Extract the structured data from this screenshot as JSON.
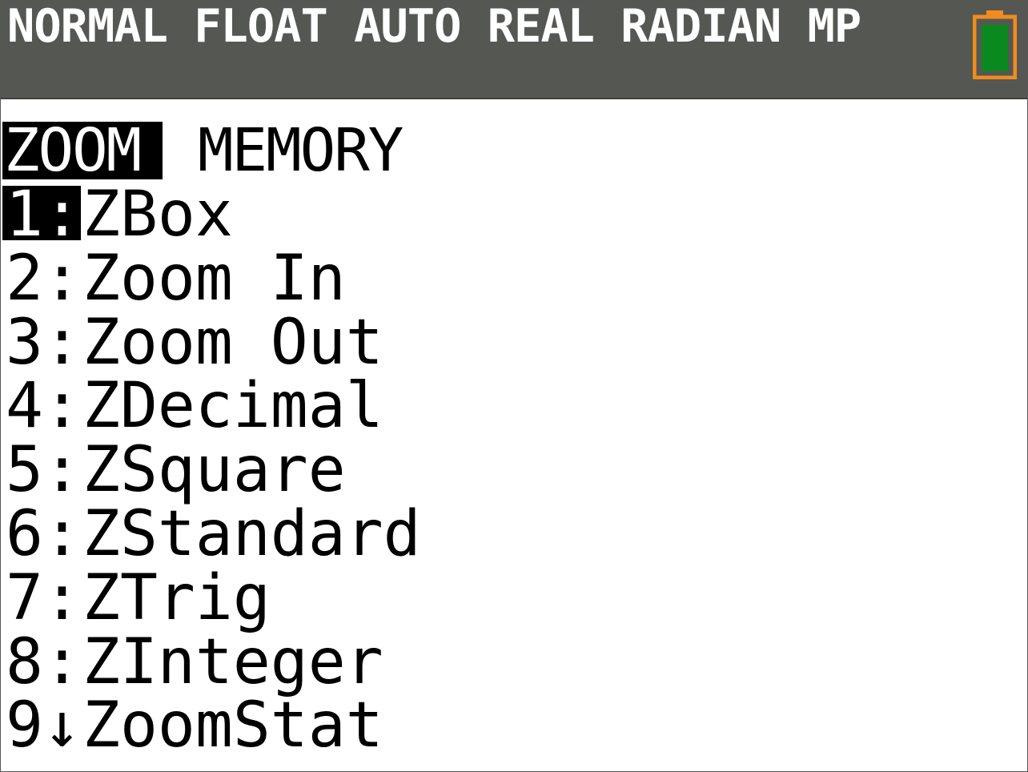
{
  "status_bar": {
    "mode_text": "NORMAL FLOAT AUTO REAL RADIAN MP",
    "battery_icon": "battery-icon",
    "colors": {
      "background": "#555752",
      "text": "#ffffff",
      "battery_outline": "#f08c1e",
      "battery_fill": "#0a8a1e"
    }
  },
  "menu": {
    "tabs": [
      {
        "label": "ZOOM",
        "selected": true
      },
      {
        "label": "MEMORY",
        "selected": false
      }
    ],
    "items": [
      {
        "number": "1:",
        "label": "ZBox",
        "selected": true
      },
      {
        "number": "2:",
        "label": "Zoom In",
        "selected": false
      },
      {
        "number": "3:",
        "label": "Zoom Out",
        "selected": false
      },
      {
        "number": "4:",
        "label": "ZDecimal",
        "selected": false
      },
      {
        "number": "5:",
        "label": "ZSquare",
        "selected": false
      },
      {
        "number": "6:",
        "label": "ZStandard",
        "selected": false
      },
      {
        "number": "7:",
        "label": "ZTrig",
        "selected": false
      },
      {
        "number": "8:",
        "label": "ZInteger",
        "selected": false
      },
      {
        "number": "9↓",
        "label": "ZoomStat",
        "selected": false
      }
    ]
  }
}
